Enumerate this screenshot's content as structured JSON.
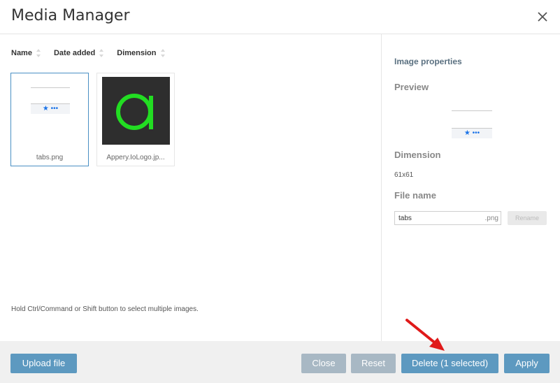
{
  "dialog": {
    "title": "Media Manager"
  },
  "sort": {
    "name": "Name",
    "date_added": "Date added",
    "dimension": "Dimension"
  },
  "files": [
    {
      "name": "tabs.png",
      "selected": true
    },
    {
      "name": "Appery.IoLogo.jp...",
      "selected": false
    }
  ],
  "hint": "Hold Ctrl/Command or Shift button to select multiple images.",
  "properties": {
    "title": "Image properties",
    "preview_label": "Preview",
    "dimension_label": "Dimension",
    "dimension_value": "61x61",
    "file_name_label": "File name",
    "file_name_value": "tabs",
    "file_ext": ".png",
    "rename_label": "Rename"
  },
  "footer": {
    "upload_label": "Upload file",
    "close_label": "Close",
    "reset_label": "Reset",
    "delete_label": "Delete (1 selected)",
    "apply_label": "Apply"
  },
  "colors": {
    "primary_button": "#5d99c0",
    "muted_button": "#a8b8c4",
    "logo_green": "#22dd22",
    "logo_bg": "#2e2e2e",
    "annotation_arrow": "#e01a1a"
  },
  "icons": {
    "close": "close-icon",
    "star": "star-icon",
    "more": "more-dots-icon",
    "sort": "sort-arrows-icon"
  }
}
